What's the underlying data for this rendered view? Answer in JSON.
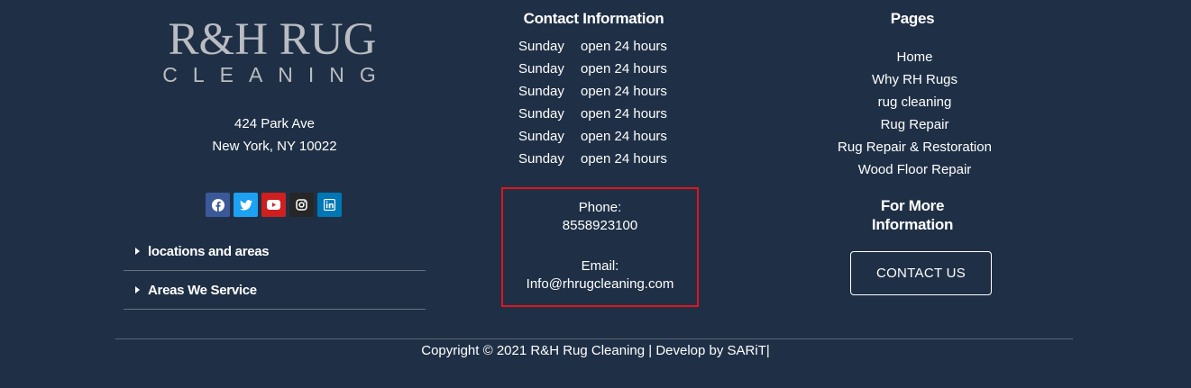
{
  "brand": {
    "logo_line1": "R&H RUG",
    "logo_line2": "CLEANING"
  },
  "address": {
    "street": "424 Park Ave",
    "city": "New York, NY 10022"
  },
  "social": [
    {
      "name": "facebook",
      "icon": "facebook-icon",
      "color": "#3b5998"
    },
    {
      "name": "twitter",
      "icon": "twitter-icon",
      "color": "#1da1f2"
    },
    {
      "name": "youtube",
      "icon": "youtube-icon",
      "color": "#cd201f"
    },
    {
      "name": "instagram",
      "icon": "instagram-icon",
      "color": "#262626"
    },
    {
      "name": "linkedin",
      "icon": "linkedin-icon",
      "color": "#0077b5"
    }
  ],
  "locations": [
    {
      "label": "locations and areas"
    },
    {
      "label": "Areas We Service"
    }
  ],
  "contact": {
    "title": "Contact Information",
    "hours": [
      {
        "day": "Sunday",
        "time": "open 24 hours"
      },
      {
        "day": "Sunday",
        "time": "open 24 hours"
      },
      {
        "day": "Sunday",
        "time": "open 24 hours"
      },
      {
        "day": "Sunday",
        "time": "open 24 hours"
      },
      {
        "day": "Sunday",
        "time": "open 24 hours"
      },
      {
        "day": "Sunday",
        "time": "open 24 hours"
      }
    ],
    "phone_label": "Phone:",
    "phone": "8558923100",
    "email_label": "Email:",
    "email": "Info@rhrugcleaning.com",
    "highlight_color": "#e2141b"
  },
  "pages": {
    "title": "Pages",
    "items": [
      "Home",
      "Why RH Rugs",
      "rug cleaning",
      "Rug Repair",
      "Rug Repair & Restoration",
      "Wood Floor Repair"
    ]
  },
  "more_info": {
    "title_line1": "For More",
    "title_line2": "Information",
    "button_label": "CONTACT US"
  },
  "footer": {
    "copyright": "Copyright © 2021 R&H Rug Cleaning | Develop by SARiT|"
  },
  "colors": {
    "background": "#1f3046",
    "logo": "#b9bcc1",
    "text": "#ffffff"
  }
}
